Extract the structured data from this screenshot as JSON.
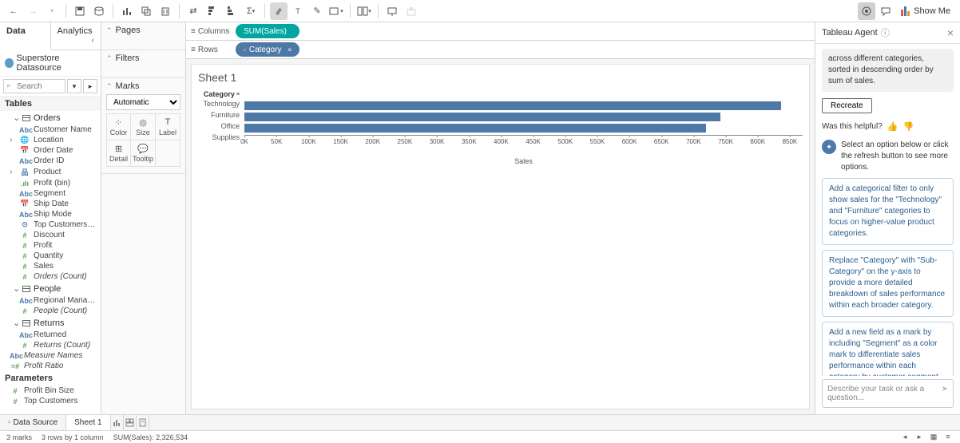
{
  "toolbar": {
    "show_me": "Show Me"
  },
  "tabs": {
    "data": "Data",
    "analytics": "Analytics"
  },
  "datasource": "Superstore Datasource",
  "search": {
    "placeholder": "Search"
  },
  "sections": {
    "tables": "Tables",
    "parameters": "Parameters"
  },
  "tables": {
    "orders": {
      "name": "Orders",
      "fields": [
        {
          "type": "Abc",
          "name": "Customer Name"
        },
        {
          "type": "geo",
          "name": "Location",
          "expand": true
        },
        {
          "type": "date",
          "name": "Order Date"
        },
        {
          "type": "Abc",
          "name": "Order ID"
        },
        {
          "type": "hier",
          "name": "Product",
          "expand": true
        },
        {
          "type": "bin",
          "name": "Profit (bin)"
        },
        {
          "type": "Abc",
          "name": "Segment"
        },
        {
          "type": "date",
          "name": "Ship Date"
        },
        {
          "type": "Abc",
          "name": "Ship Mode"
        },
        {
          "type": "set",
          "name": "Top Customers by P..."
        },
        {
          "type": "#",
          "name": "Discount"
        },
        {
          "type": "#",
          "name": "Profit"
        },
        {
          "type": "#",
          "name": "Quantity"
        },
        {
          "type": "#",
          "name": "Sales"
        },
        {
          "type": "#",
          "name": "Orders (Count)",
          "italic": true
        }
      ]
    },
    "people": {
      "name": "People",
      "fields": [
        {
          "type": "Abc",
          "name": "Regional Manager"
        },
        {
          "type": "#",
          "name": "People (Count)",
          "italic": true
        }
      ]
    },
    "returns": {
      "name": "Returns",
      "fields": [
        {
          "type": "Abc",
          "name": "Returned"
        },
        {
          "type": "#",
          "name": "Returns (Count)",
          "italic": true
        }
      ]
    }
  },
  "loose_fields": [
    {
      "type": "Abc",
      "name": "Measure Names",
      "italic": true
    },
    {
      "type": "calc",
      "name": "Profit Ratio",
      "italic": true
    }
  ],
  "parameters": [
    {
      "type": "#",
      "name": "Profit Bin Size"
    },
    {
      "type": "#",
      "name": "Top Customers"
    }
  ],
  "shelves": {
    "pages": "Pages",
    "filters": "Filters",
    "marks": "Marks",
    "marks_type": "Automatic",
    "marks_cells": [
      "Color",
      "Size",
      "Label",
      "Detail",
      "Tooltip"
    ]
  },
  "colrow": {
    "columns": "Columns",
    "rows": "Rows",
    "col_pill": "SUM(Sales)",
    "row_pill": "Category"
  },
  "sheet_title": "Sheet 1",
  "chart_data": {
    "type": "bar",
    "category_header": "Category",
    "categories": [
      "Technology",
      "Furniture",
      "Office Supplies"
    ],
    "values": [
      836000,
      742000,
      719000
    ],
    "xlabel": "Sales",
    "xticks": [
      "0K",
      "50K",
      "100K",
      "150K",
      "200K",
      "250K",
      "300K",
      "350K",
      "400K",
      "450K",
      "500K",
      "550K",
      "600K",
      "650K",
      "700K",
      "750K",
      "800K",
      "850K"
    ],
    "xmax": 870000
  },
  "agent": {
    "title": "Tableau Agent",
    "summary": "across different categories, sorted in descending order by sum of sales.",
    "recreate": "Recreate",
    "helpful": "Was this helpful?",
    "prompt": "Select an option below or click the refresh button to see more options.",
    "options": [
      "Add a categorical filter to only show sales for the \"Technology\" and \"Furniture\" categories to focus on higher-value product categories.",
      "Replace \"Category\" with \"Sub-Category\" on the y-axis to provide a more detailed breakdown of sales performance within each broader category.",
      "Add a new field as a mark by including \"Segment\" as a color mark to differentiate sales performance within each category by customer segment."
    ],
    "chat_placeholder": "Describe your task or ask a question..."
  },
  "bottom": {
    "data_source": "Data Source",
    "sheet": "Sheet 1"
  },
  "status": {
    "marks": "3 marks",
    "rows_cols": "3 rows by 1 column",
    "sum": "SUM(Sales): 2,326,534"
  }
}
